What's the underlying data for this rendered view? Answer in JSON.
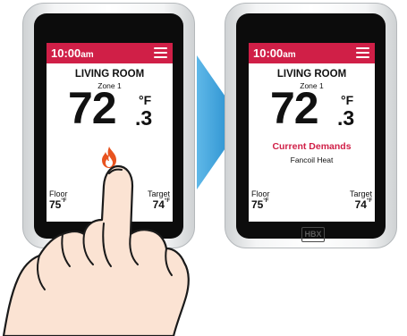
{
  "colors": {
    "accent": "#d01f47",
    "arrow": "#1a95d3",
    "screen_face": "#0c0c0c"
  },
  "before": {
    "time": "10:00",
    "ampm": "am",
    "room": "LIVING ROOM",
    "zone": "Zone 1",
    "temp_whole": "72",
    "temp_decimal": ".3",
    "temp_unit": "°F",
    "floor_label": "Floor",
    "floor_value": "75",
    "floor_unit": "°F",
    "target_label": "Target",
    "target_value": "74",
    "target_unit": "°F",
    "icon": "flame-icon"
  },
  "after": {
    "time": "10:00",
    "ampm": "am",
    "room": "LIVING ROOM",
    "zone": "Zone 1",
    "temp_whole": "72",
    "temp_decimal": ".3",
    "temp_unit": "°F",
    "demand_title": "Current Demands",
    "demand_item": "Fancoil Heat",
    "floor_label": "Floor",
    "floor_value": "75",
    "floor_unit": "°F",
    "target_label": "Target",
    "target_value": "74",
    "target_unit": "°F",
    "brand_logo": "HBX"
  },
  "transition_icon": "arrow-right-icon",
  "gesture_icon": "hand-pointer-icon"
}
